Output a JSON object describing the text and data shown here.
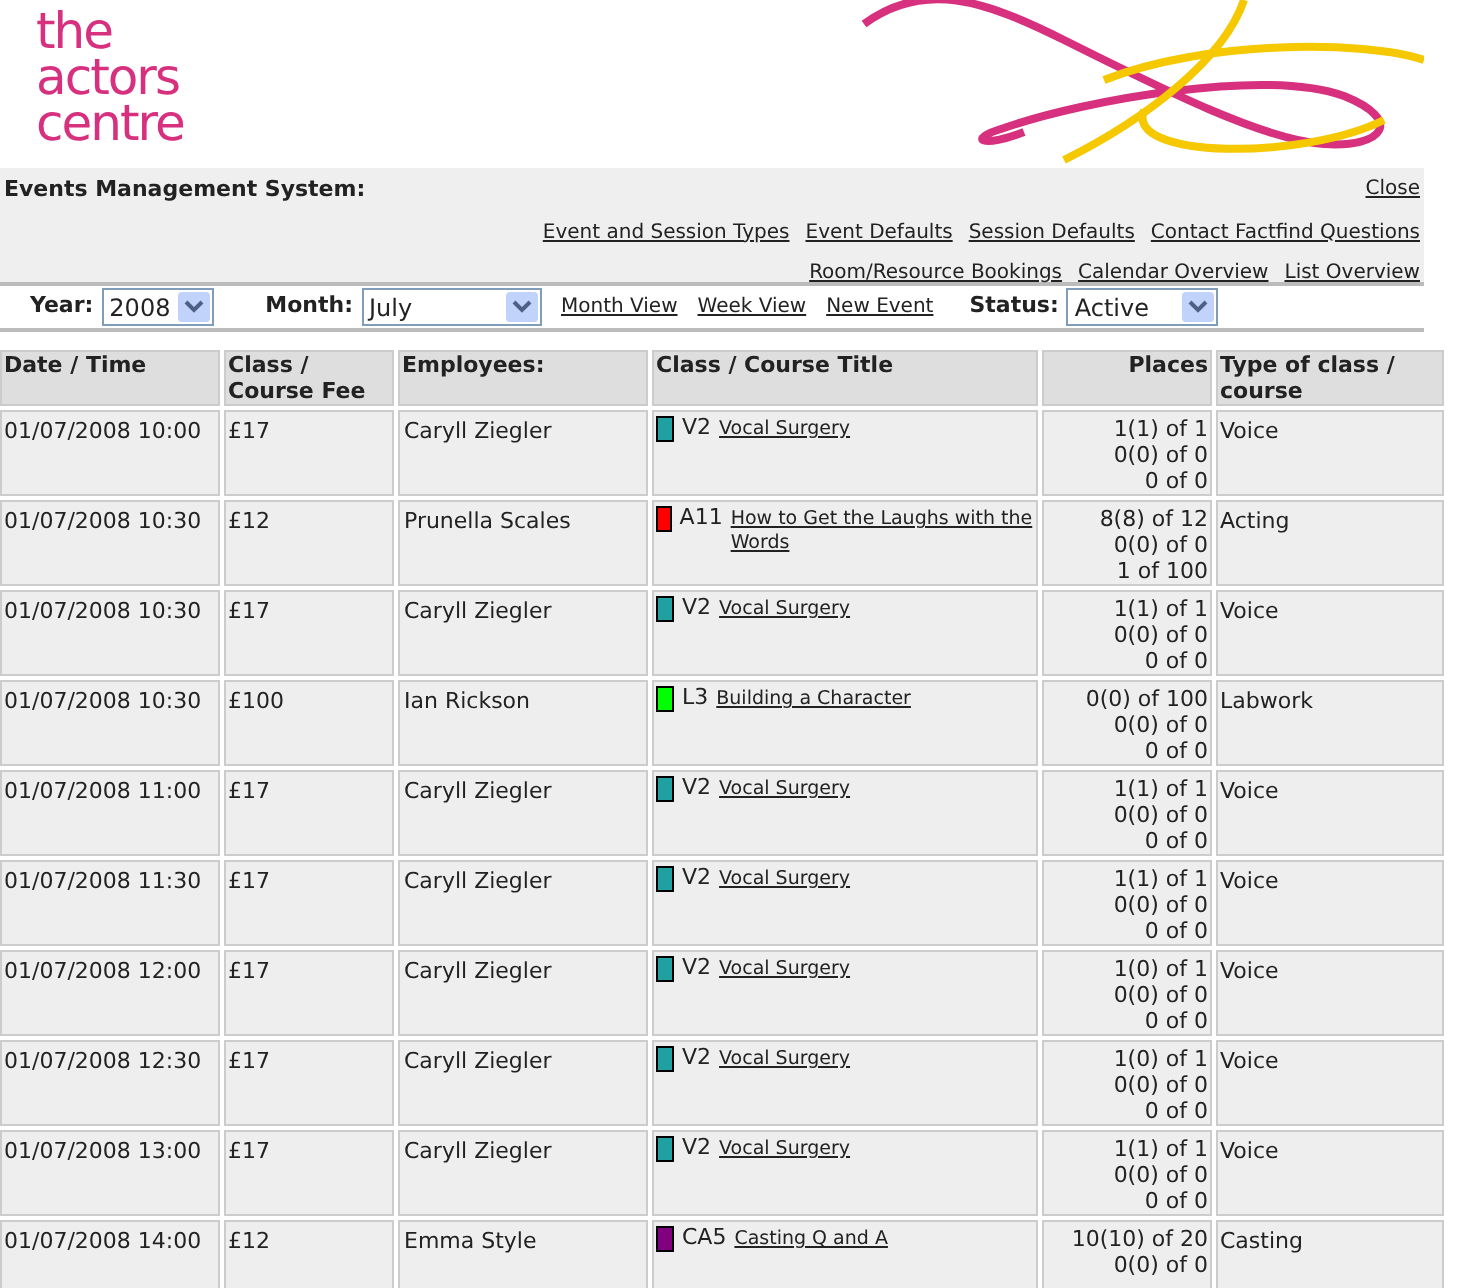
{
  "logo": {
    "lines": [
      "the",
      "actors",
      "centre"
    ]
  },
  "header": {
    "title": "Events Management System:",
    "close": "Close",
    "links_row_1": [
      "Event and Session Types",
      "Event Defaults",
      "Session Defaults",
      "Contact Factfind Questions"
    ],
    "links_row_2": [
      "Room/Resource Bookings",
      "Calendar Overview",
      "List Overview"
    ]
  },
  "filters": {
    "year_label": "Year:",
    "year": "2008",
    "month_label": "Month:",
    "month": "July",
    "links": [
      "Month View",
      "Week View",
      "New Event"
    ],
    "status_label": "Status:",
    "status": "Active"
  },
  "table": {
    "columns": [
      "Date / Time",
      "Class / Course Fee",
      "Employees:",
      "Class / Course Title",
      "Places",
      "Type of class / course"
    ],
    "rows": [
      {
        "date": "01/07/2008 10:00",
        "fee": "£17",
        "employee": "Caryll Ziegler",
        "color": "#20a0a0",
        "code": "V2",
        "title": "Vocal Surgery",
        "places": [
          "1(1) of 1",
          "0(0) of 0",
          "0 of 0"
        ],
        "type": "Voice"
      },
      {
        "date": "01/07/2008 10:30",
        "fee": "£12",
        "employee": "Prunella Scales",
        "color": "#ff0000",
        "code": "A11",
        "title": "How to Get the Laughs with the Words",
        "places": [
          "8(8) of 12",
          "0(0) of 0",
          "1 of 100"
        ],
        "type": "Acting"
      },
      {
        "date": "01/07/2008 10:30",
        "fee": "£17",
        "employee": "Caryll Ziegler",
        "color": "#20a0a0",
        "code": "V2",
        "title": "Vocal Surgery",
        "places": [
          "1(1) of 1",
          "0(0) of 0",
          "0 of 0"
        ],
        "type": "Voice"
      },
      {
        "date": "01/07/2008 10:30",
        "fee": "£100",
        "employee": "Ian Rickson",
        "color": "#00ff00",
        "code": "L3",
        "title": "Building a Character",
        "places": [
          "0(0) of 100",
          "0(0) of 0",
          "0 of 0"
        ],
        "type": "Labwork"
      },
      {
        "date": "01/07/2008 11:00",
        "fee": "£17",
        "employee": "Caryll Ziegler",
        "color": "#20a0a0",
        "code": "V2",
        "title": "Vocal Surgery",
        "places": [
          "1(1) of 1",
          "0(0) of 0",
          "0 of 0"
        ],
        "type": "Voice"
      },
      {
        "date": "01/07/2008 11:30",
        "fee": "£17",
        "employee": "Caryll Ziegler",
        "color": "#20a0a0",
        "code": "V2",
        "title": "Vocal Surgery",
        "places": [
          "1(1) of 1",
          "0(0) of 0",
          "0 of 0"
        ],
        "type": "Voice"
      },
      {
        "date": "01/07/2008 12:00",
        "fee": "£17",
        "employee": "Caryll Ziegler",
        "color": "#20a0a0",
        "code": "V2",
        "title": "Vocal Surgery",
        "places": [
          "1(0) of 1",
          "0(0) of 0",
          "0 of 0"
        ],
        "type": "Voice"
      },
      {
        "date": "01/07/2008 12:30",
        "fee": "£17",
        "employee": "Caryll Ziegler",
        "color": "#20a0a0",
        "code": "V2",
        "title": "Vocal Surgery",
        "places": [
          "1(0) of 1",
          "0(0) of 0",
          "0 of 0"
        ],
        "type": "Voice"
      },
      {
        "date": "01/07/2008 13:00",
        "fee": "£17",
        "employee": "Caryll Ziegler",
        "color": "#20a0a0",
        "code": "V2",
        "title": "Vocal Surgery",
        "places": [
          "1(1) of 1",
          "0(0) of 0",
          "0 of 0"
        ],
        "type": "Voice"
      },
      {
        "date": "01/07/2008 14:00",
        "fee": "£12",
        "employee": "Emma Style",
        "color": "#800080",
        "code": "CA5",
        "title": "Casting Q and A",
        "places": [
          "10(10) of 20",
          "0(0) of 0"
        ],
        "type": "Casting"
      }
    ]
  }
}
